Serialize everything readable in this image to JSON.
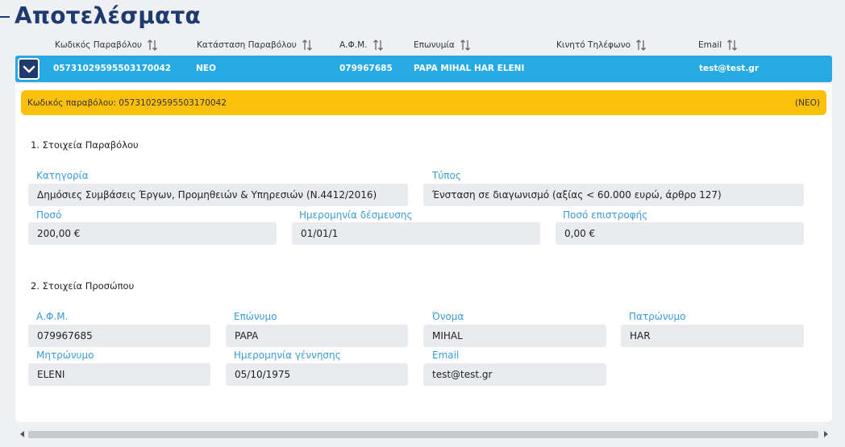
{
  "page": {
    "title": "Αποτελέσματα"
  },
  "table": {
    "columns": [
      {
        "label": "Κωδικός Παραβόλου"
      },
      {
        "label": "Κατάσταση Παραβόλου"
      },
      {
        "label": "Α.Φ.Μ."
      },
      {
        "label": "Επωνυμία"
      },
      {
        "label": "Κινητό Τηλέφωνο"
      },
      {
        "label": "Email"
      }
    ],
    "row": {
      "code": "05731029595503170042",
      "status": "ΝΕΟ",
      "afm": "079967685",
      "name": "PAPA MIHAL HAR ELENI",
      "mobile": "",
      "email": "test@test.gr"
    }
  },
  "detail": {
    "banner_left": "Κωδικός παραβόλου: 05731029595503170042",
    "banner_right": "(ΝΕΟ)",
    "section1": {
      "title": "1. Στοιχεία Παραβόλου",
      "category_label": "Κατηγορία",
      "category_value": "Δημόσιες Συμβάσεις Έργων, Προμηθειών & Υπηρεσιών (Ν.4412/2016)",
      "type_label": "Τύπος",
      "type_value": "Ένσταση σε διαγωνισμό (αξίας < 60.000 ευρώ, άρθρο 127)",
      "amount_label": "Ποσό",
      "amount_value": "200,00 €",
      "commit_date_label": "Ημερομηνία δέσμευσης",
      "commit_date_value": "01/01/1",
      "refund_label": "Ποσό επιστροφής",
      "refund_value": "0,00 €"
    },
    "section2": {
      "title": "2. Στοιχεία Προσώπου",
      "afm_label": "Α.Φ.Μ.",
      "afm_value": "079967685",
      "surname_label": "Επώνυμο",
      "surname_value": "PAPA",
      "firstname_label": "Όνομα",
      "firstname_value": "MIHAL",
      "father_label": "Πατρώνυμο",
      "father_value": "HAR",
      "mother_label": "Μητρώνυμο",
      "mother_value": "ELENI",
      "dob_label": "Ημερομηνία γέννησης",
      "dob_value": "05/10/1975",
      "email_label": "Email",
      "email_value": "test@test.gr"
    }
  },
  "colors": {
    "title": "#1f3a6e",
    "row_bg": "#27aae1",
    "banner_bg": "#fbc10a",
    "label": "#3a9bd5",
    "field_bg": "#e9ebef"
  },
  "icons": [
    "sort-icon",
    "chevron-down-icon",
    "scroll-left-icon",
    "scroll-right-icon"
  ]
}
